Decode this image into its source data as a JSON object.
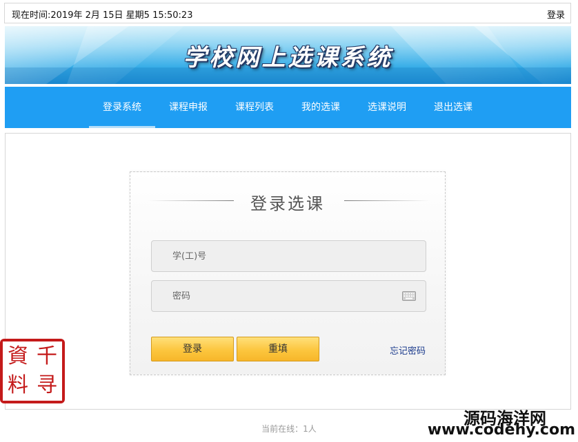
{
  "topbar": {
    "time_label": "现在时间:2019年 2月 15日 星期5 15:50:23",
    "login_link": "登录"
  },
  "banner": {
    "title": "学校网上选课系统"
  },
  "nav": {
    "items": [
      {
        "label": "登录系统",
        "active": true
      },
      {
        "label": "课程申报",
        "active": false
      },
      {
        "label": "课程列表",
        "active": false
      },
      {
        "label": "我的选课",
        "active": false
      },
      {
        "label": "选课说明",
        "active": false
      },
      {
        "label": "退出选课",
        "active": false
      }
    ]
  },
  "login": {
    "heading": "登录选课",
    "username_placeholder": "学(工)号",
    "password_placeholder": "密码",
    "login_button": "登录",
    "reset_button": "重填",
    "forgot_link": "忘记密码"
  },
  "footer": {
    "online_text": "当前在线：1人"
  },
  "watermark": {
    "seal_chars": [
      "千",
      "資",
      "寻",
      "料"
    ],
    "site_name": "源码海洋网",
    "site_url": "www.codehy.com"
  },
  "colors": {
    "nav_bg": "#1f9ef3",
    "button_gold": "#fcc63e",
    "link_blue": "#1a3a8c",
    "seal_red": "#c41a1a"
  }
}
